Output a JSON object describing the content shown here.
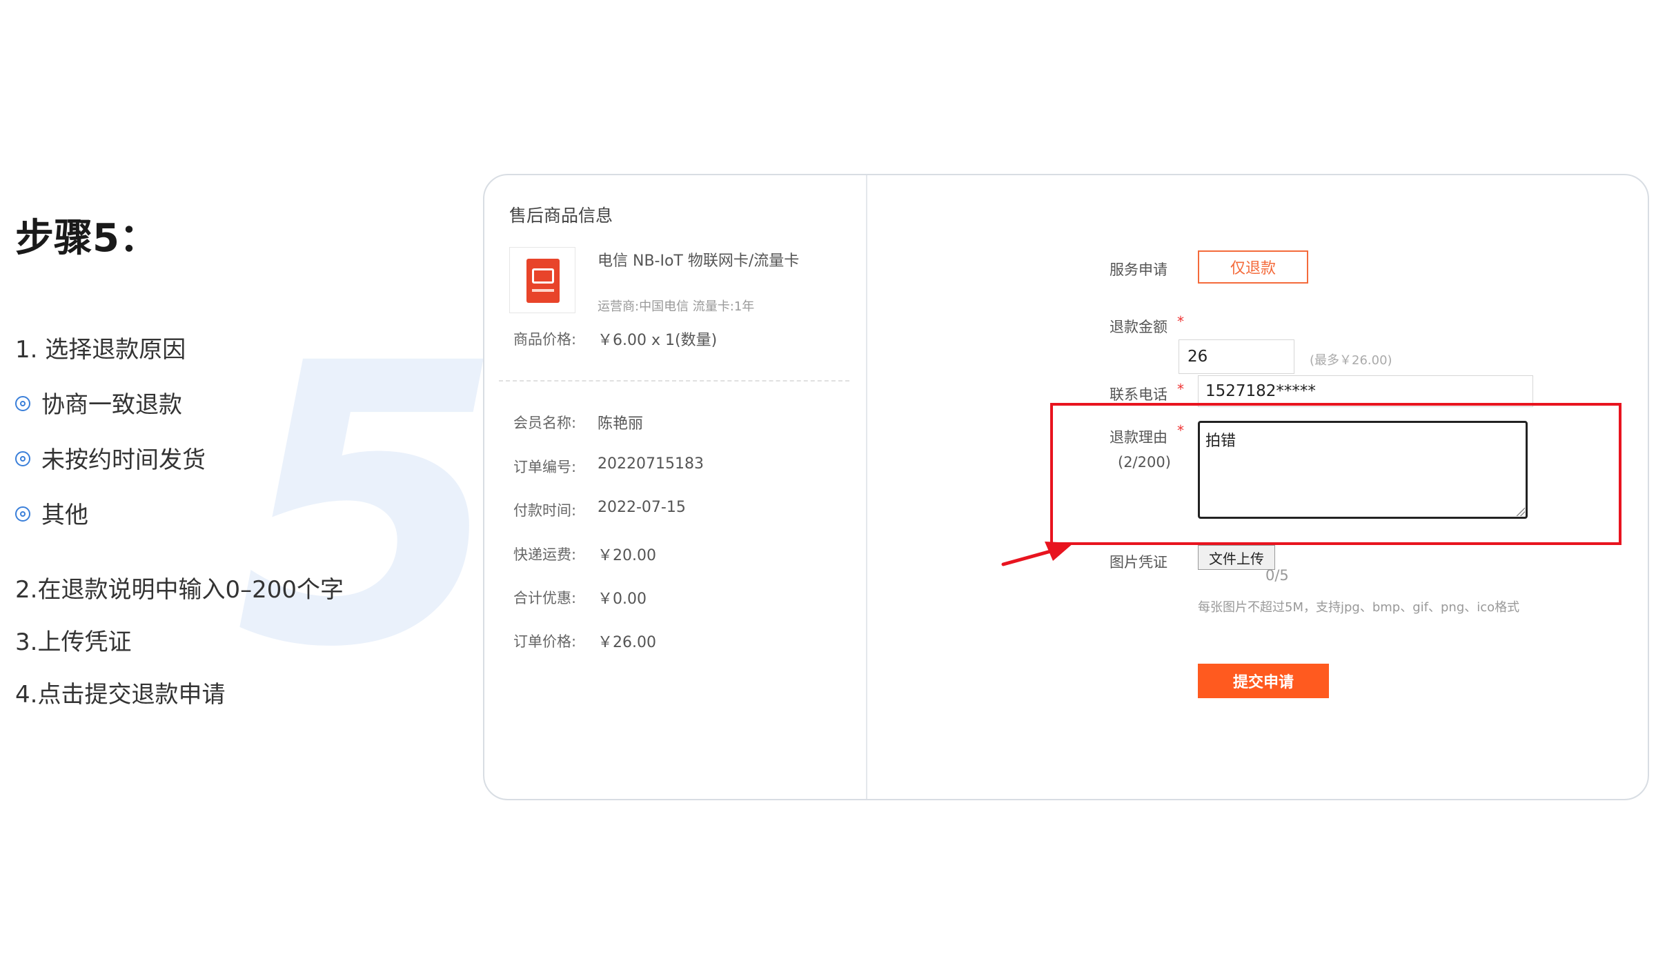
{
  "left": {
    "step_title": "步骤5：",
    "big_number": "5",
    "line1": "1. 选择退款原因",
    "options": [
      "协商一致退款",
      "未按约时间发货",
      "其他"
    ],
    "line2": "2.在退款说明中输入0–200个字",
    "line3": "3.上传凭证",
    "line4": "4.点击提交退款申请"
  },
  "product": {
    "section_title": "售后商品信息",
    "name": "电信 NB-IoT 物联网卡/流量卡",
    "attrs": "运营商:中国电信 流量卡:1年",
    "price_label": "商品价格:",
    "price_value": "￥6.00 x 1(数量)"
  },
  "order": {
    "member_label": "会员名称:",
    "member_value": "陈艳丽",
    "order_no_label": "订单编号:",
    "order_no_value": "20220715183",
    "pay_time_label": "付款时间:",
    "pay_time_value": "2022-07-15",
    "shipping_label": "快递运费:",
    "shipping_value": "￥20.00",
    "discount_label": "合计优惠:",
    "discount_value": "￥0.00",
    "total_label": "订单价格:",
    "total_value": "￥26.00"
  },
  "form": {
    "service_label": "服务申请",
    "service_option": "仅退款",
    "amount_label": "退款金额",
    "amount_value": "26",
    "amount_hint": "(最多￥26.00)",
    "phone_label": "联系电话",
    "phone_value": "1527182*****",
    "reason_label": "退款理由",
    "reason_count": "(2/200)",
    "reason_value": "拍错",
    "photo_label": "图片凭证",
    "upload_label": "文件上传",
    "upload_count": "0/5",
    "upload_hint": "每张图片不超过5M，支持jpg、bmp、gif、png、ico格式",
    "submit_label": "提交申请",
    "required_mark": "*"
  },
  "colors": {
    "accent_orange": "#ff5a1f",
    "highlight_red": "#e8141f",
    "option_blue": "#3a7fd9"
  }
}
